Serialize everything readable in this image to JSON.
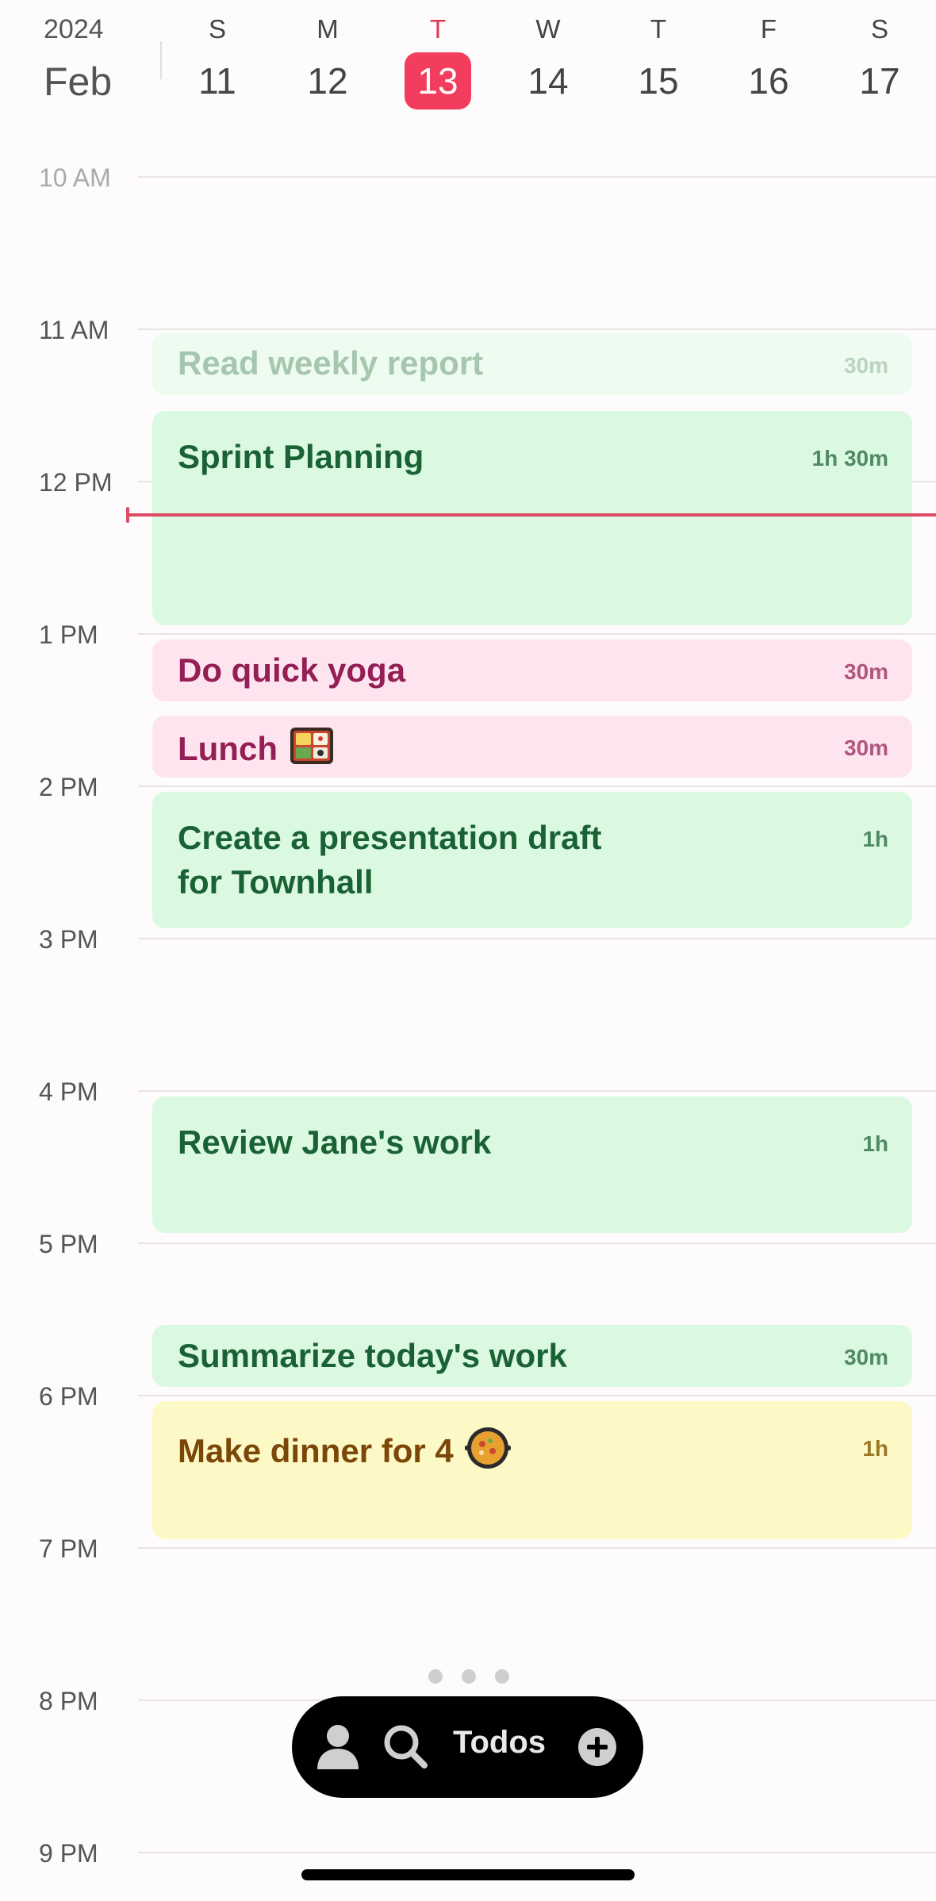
{
  "header": {
    "year": "2024",
    "month": "Feb",
    "days": [
      {
        "dow": "S",
        "num": "11"
      },
      {
        "dow": "M",
        "num": "12"
      },
      {
        "dow": "T",
        "num": "13",
        "today": true
      },
      {
        "dow": "W",
        "num": "14"
      },
      {
        "dow": "T",
        "num": "15"
      },
      {
        "dow": "F",
        "num": "16"
      },
      {
        "dow": "S",
        "num": "17"
      }
    ]
  },
  "timeline": {
    "hours": [
      "10 AM",
      "11 AM",
      "12 PM",
      "1 PM",
      "2 PM",
      "3 PM",
      "4 PM",
      "5 PM",
      "6 PM",
      "7 PM",
      "8 PM",
      "9 PM"
    ]
  },
  "events": [
    {
      "title": "Read weekly report",
      "duration": "30m",
      "color": "green",
      "faded": true
    },
    {
      "title": "Sprint Planning",
      "duration": "1h 30m",
      "color": "green"
    },
    {
      "title": "Do quick yoga",
      "duration": "30m",
      "color": "pink"
    },
    {
      "title": "Lunch",
      "duration": "30m",
      "color": "pink",
      "icon": "bento-box-icon"
    },
    {
      "title_line1": "Create a presentation draft",
      "title_line2": "for Townhall",
      "duration": "1h",
      "color": "green"
    },
    {
      "title": "Review Jane's work",
      "duration": "1h",
      "color": "green"
    },
    {
      "title": "Summarize today's work",
      "duration": "30m",
      "color": "green"
    },
    {
      "title": "Make dinner for 4",
      "duration": "1h",
      "color": "yellow",
      "icon": "paella-pan-icon"
    }
  ],
  "colors": {
    "accent": "#f23d5e",
    "now_line": "#dc4a63",
    "green_bg": "#dbf9e1",
    "pink_bg": "#fde4ef",
    "yellow_bg": "#fdf9c6"
  },
  "toolbar": {
    "todos_label": "Todos",
    "icons": [
      "profile-icon",
      "search-icon",
      "add-icon"
    ]
  }
}
